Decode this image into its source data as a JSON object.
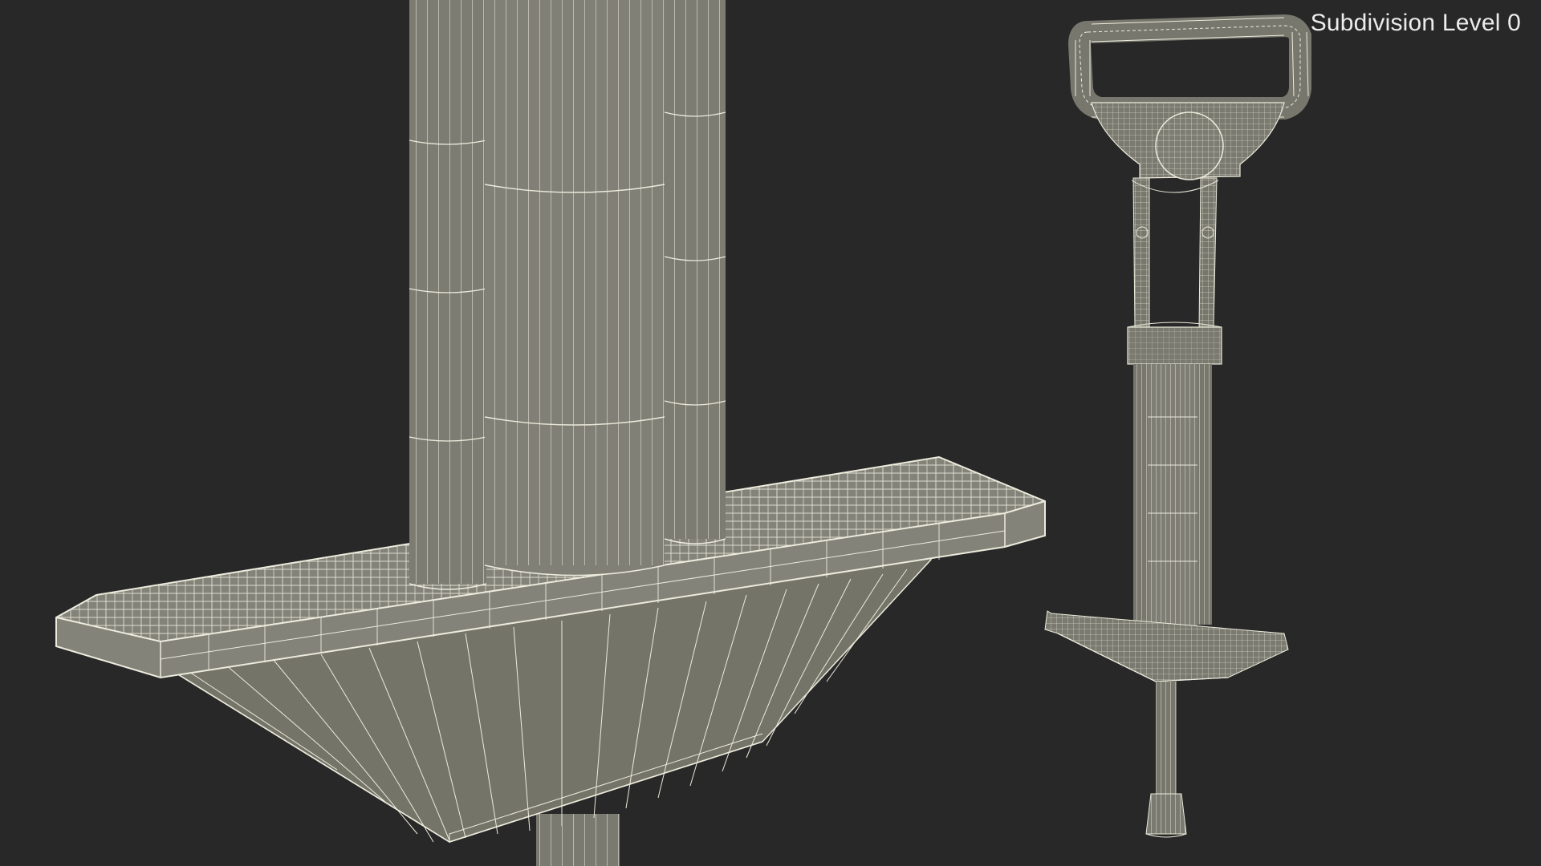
{
  "viewport": {
    "label": "Subdivision Level 0",
    "background_color": "#282828"
  },
  "model": {
    "mesh_fill_color": "#7c7c72",
    "mesh_shade_color": "#6a6a62",
    "wire_color": "#ecebdc"
  }
}
